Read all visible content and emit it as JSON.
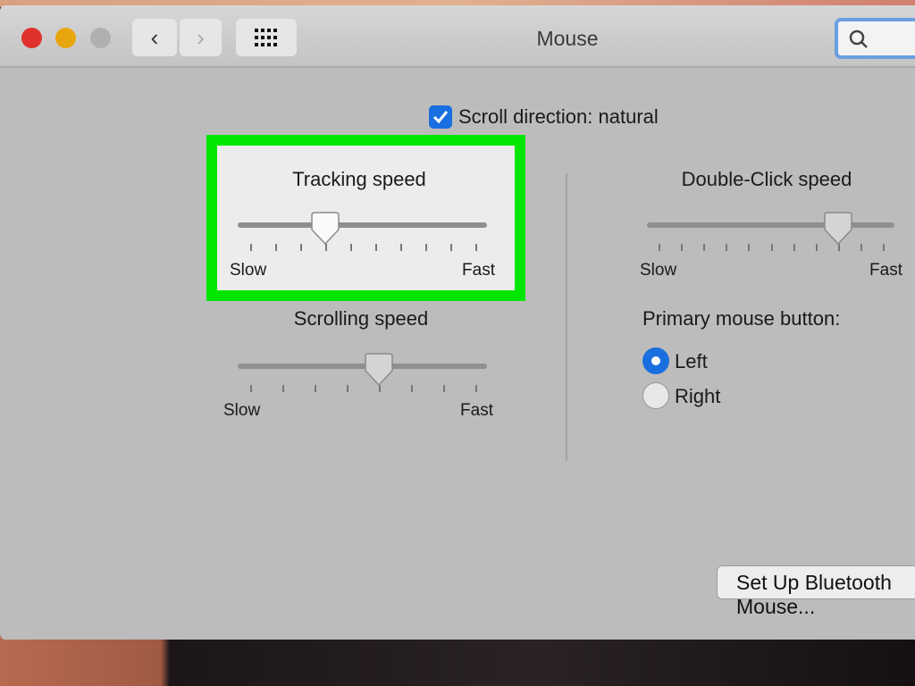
{
  "window": {
    "title": "Mouse",
    "traffic_lights": {
      "close": "#e0312c",
      "minimize": "#e8a60e",
      "zoom": "#a8a8a8"
    },
    "back_icon": "chevron-left-icon",
    "forward_icon": "chevron-right-icon",
    "grid_icon": "grid-icon",
    "search_icon": "search-icon"
  },
  "scroll_direction": {
    "label": "Scroll direction: natural",
    "checked": true
  },
  "tracking": {
    "title": "Tracking speed",
    "min_label": "Slow",
    "max_label": "Fast",
    "ticks": 10,
    "value_index": 3,
    "highlighted": true,
    "highlight_color": "#00e600"
  },
  "scrolling": {
    "title": "Scrolling speed",
    "min_label": "Slow",
    "max_label": "Fast",
    "ticks": 8,
    "value_index": 4
  },
  "double_click": {
    "title": "Double-Click speed",
    "min_label": "Slow",
    "max_label": "Fast",
    "ticks": 11,
    "value_index": 8
  },
  "primary_button": {
    "title": "Primary mouse button:",
    "options": [
      {
        "label": "Left",
        "selected": true
      },
      {
        "label": "Right",
        "selected": false
      }
    ],
    "accent": "#1a6fe0"
  },
  "bluetooth_button": "Set Up Bluetooth Mouse..."
}
